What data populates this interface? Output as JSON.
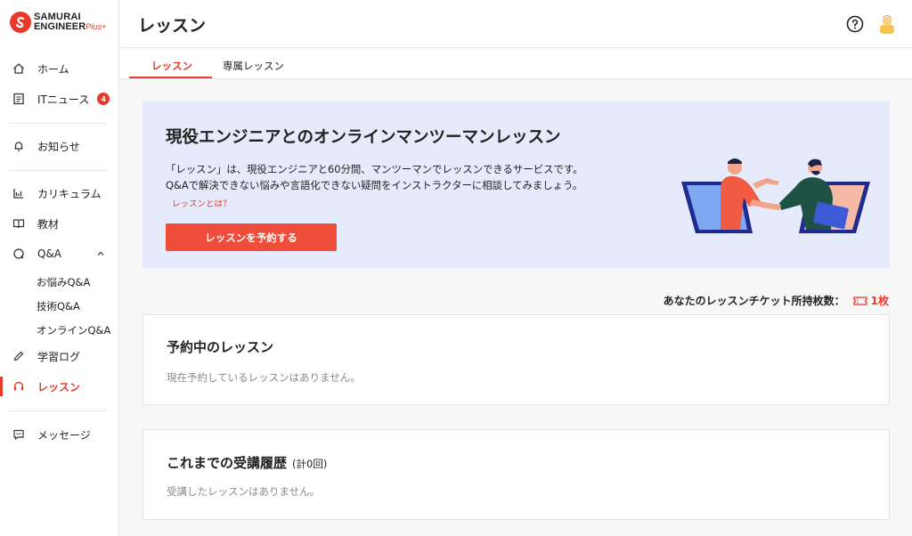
{
  "brand": {
    "line1": "SAMURAI",
    "line2": "ENGINEER",
    "line2_suffix": "Plus+"
  },
  "sidebar": {
    "home": "ホーム",
    "it_news": "ITニュース",
    "it_news_badge": "4",
    "notifications": "お知らせ",
    "curriculum": "カリキュラム",
    "materials": "教材",
    "qa": "Q&A",
    "qa_sub": [
      "お悩みQ&A",
      "技術Q&A",
      "オンラインQ&A"
    ],
    "study_log": "学習ログ",
    "lessons": "レッスン",
    "messages": "メッセージ"
  },
  "header": {
    "title": "レッスン"
  },
  "tabs": [
    {
      "label": "レッスン",
      "active": true
    },
    {
      "label": "専属レッスン",
      "active": false
    }
  ],
  "hero": {
    "title": "現役エンジニアとのオンラインマンツーマンレッスン",
    "desc_line1": "「レッスン」は、現役エンジニアと60分間、マンツーマンでレッスンできるサービスです。",
    "desc_line2": "Q&Aで解決できない悩みや言語化できない疑問をインストラクターに相談してみましょう。",
    "link": "レッスンとは？",
    "button": "レッスンを予約する"
  },
  "tickets": {
    "label": "あなたのレッスンチケット所持枚数：",
    "count": "1枚"
  },
  "booked": {
    "title": "予約中のレッスン",
    "empty": "現在予約しているレッスンはありません。"
  },
  "history": {
    "title": "これまでの受講履歴",
    "count": "(計0回)",
    "empty": "受講したレッスンはありません。"
  },
  "colors": {
    "accent": "#e8392b",
    "hero_bg": "#e6ebfb"
  }
}
